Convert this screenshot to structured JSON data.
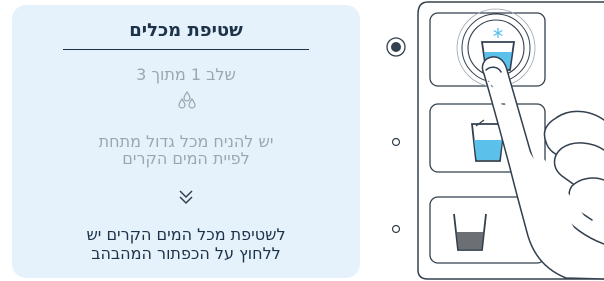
{
  "card": {
    "title": "שטיפת מכלים",
    "step": "שלב 1 מתוך 3",
    "instruction_line1": "יש להניח מכל גדול מתחת",
    "instruction_line2": "לפיית המים הקרים",
    "action_line1": "לשטיפת מכל המים הקרים יש",
    "action_line2": "ללחוץ על הכפתור המהבהב"
  },
  "icons": {
    "drops": "water-drops-icon",
    "chevrons": "double-chevron-down-icon",
    "cold": "snowflake-icon",
    "cup": "cup-icon"
  },
  "colors": {
    "card_bg": "#e6f2fb",
    "text_dark": "#1d3349",
    "text_muted": "#9aa7b2",
    "water_blue": "#5bc0ea",
    "outline": "#33404d"
  }
}
